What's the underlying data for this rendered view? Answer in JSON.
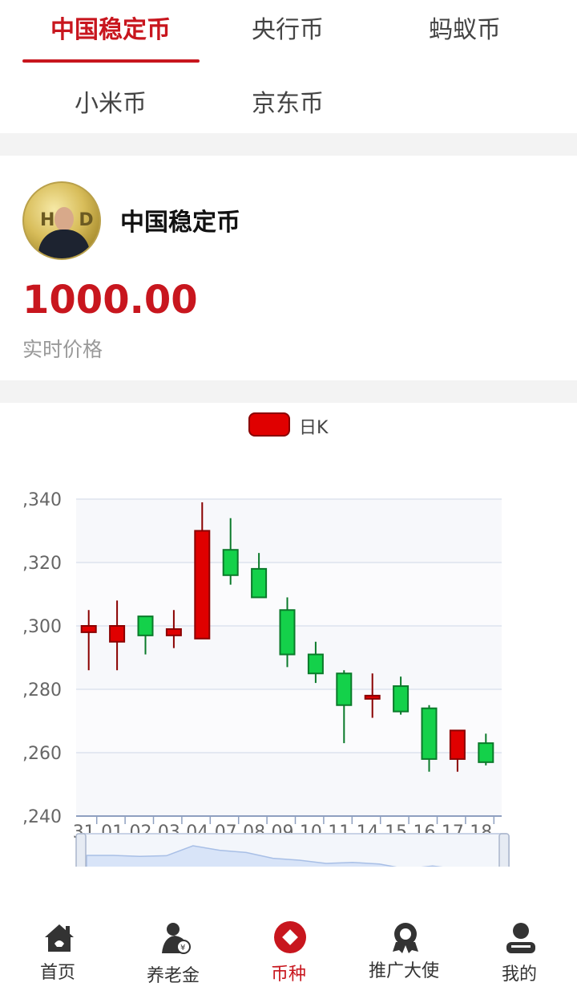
{
  "tabs": [
    {
      "label": "中国稳定币",
      "active": true
    },
    {
      "label": "央行币",
      "active": false
    },
    {
      "label": "蚂蚁币",
      "active": false
    },
    {
      "label": "小米币",
      "active": false
    },
    {
      "label": "京东币",
      "active": false
    }
  ],
  "coin": {
    "avatar_text": "HD",
    "name": "中国稳定币",
    "price": "1000.00",
    "price_label": "实时价格"
  },
  "legend": {
    "label": "日K",
    "color": "#e00000"
  },
  "chart_data": {
    "type": "candlestick",
    "title": "",
    "legend": [
      "日K"
    ],
    "ylim": [
      240,
      340
    ],
    "ytick_labels": [
      ",340",
      ",320",
      ",300",
      ",280",
      ",260",
      ",240"
    ],
    "yticks": [
      340,
      320,
      300,
      280,
      260,
      240
    ],
    "categories": [
      "31",
      "01",
      "02",
      "03",
      "04",
      "07",
      "08",
      "09",
      "10",
      "11",
      "14",
      "15",
      "16",
      "17",
      "18"
    ],
    "candles": [
      {
        "open": 298,
        "close": 300,
        "low": 286,
        "high": 305,
        "color": "red"
      },
      {
        "open": 295,
        "close": 300,
        "low": 286,
        "high": 308,
        "color": "red"
      },
      {
        "open": 303,
        "close": 297,
        "low": 291,
        "high": 303,
        "color": "green"
      },
      {
        "open": 297,
        "close": 299,
        "low": 293,
        "high": 305,
        "color": "red"
      },
      {
        "open": 296,
        "close": 330,
        "low": 296,
        "high": 339,
        "color": "red"
      },
      {
        "open": 324,
        "close": 316,
        "low": 313,
        "high": 334,
        "color": "green"
      },
      {
        "open": 318,
        "close": 309,
        "low": 309,
        "high": 323,
        "color": "green"
      },
      {
        "open": 305,
        "close": 291,
        "low": 287,
        "high": 309,
        "color": "green"
      },
      {
        "open": 291,
        "close": 285,
        "low": 282,
        "high": 295,
        "color": "green"
      },
      {
        "open": 285,
        "close": 275,
        "low": 263,
        "high": 286,
        "color": "green"
      },
      {
        "open": 277,
        "close": 278,
        "low": 271,
        "high": 285,
        "color": "red"
      },
      {
        "open": 281,
        "close": 273,
        "low": 272,
        "high": 284,
        "color": "green"
      },
      {
        "open": 274,
        "close": 258,
        "low": 254,
        "high": 275,
        "color": "green"
      },
      {
        "open": 258,
        "close": 267,
        "low": 254,
        "high": 267,
        "color": "red"
      },
      {
        "open": 263,
        "close": 257,
        "low": 256,
        "high": 266,
        "color": "green"
      }
    ],
    "colors": {
      "up": "#e00000",
      "up_border": "#8a0000",
      "down": "#14d14a",
      "down_border": "#0a7a2a"
    },
    "grid": true,
    "datazoom": true
  },
  "bottom_nav": [
    {
      "label": "首页",
      "icon": "home-icon",
      "active": false
    },
    {
      "label": "养老金",
      "icon": "pension-icon",
      "active": false
    },
    {
      "label": "币种",
      "icon": "currency-icon",
      "active": true
    },
    {
      "label": "推广大使",
      "icon": "ambassador-icon",
      "active": false
    },
    {
      "label": "我的",
      "icon": "user-icon",
      "active": false
    }
  ],
  "theme": {
    "accent": "#c8161e"
  }
}
